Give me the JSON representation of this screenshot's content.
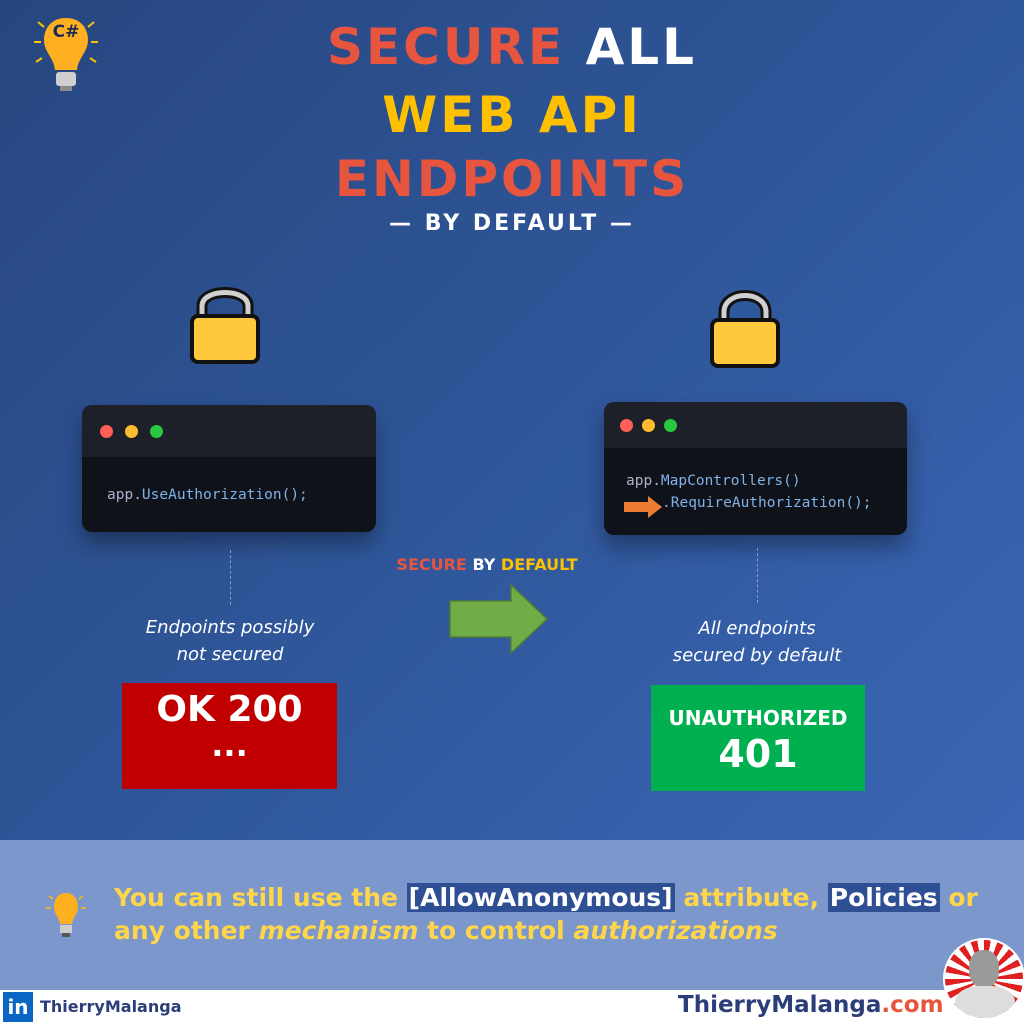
{
  "logo": {
    "text": "C#",
    "icon": "lightbulb-icon"
  },
  "title": {
    "secure": "SECURE",
    "all": "ALL",
    "web_api": "WEB API",
    "endpoints": "ENDPOINTS",
    "subtitle": "— BY DEFAULT —"
  },
  "left": {
    "icon": "padlock-open-icon",
    "code_prefix": "app.",
    "code_method": "UseAuthorization();",
    "caption_line1": "Endpoints possibly",
    "caption_line2": "not secured",
    "status_line1": "OK 200",
    "status_line2": "...",
    "status_color": "#c00000"
  },
  "middle": {
    "secure": "SECURE",
    "by": "BY",
    "default": "DEFAULT",
    "icon": "arrow-right-icon"
  },
  "right": {
    "icon": "padlock-closed-icon",
    "code_line1_prefix": "app.",
    "code_line1_method": "MapControllers()",
    "code_line2": ".RequireAuthorization();",
    "caption_line1": "All endpoints",
    "caption_line2": "secured by default",
    "status_line1": "UNAUTHORIZED",
    "status_line2": "401",
    "status_color": "#00b050"
  },
  "tip": {
    "p1": "You can still use the ",
    "h1": "[AllowAnonymous]",
    "p2": " attribute, ",
    "h2": "Policies",
    "p3": " or any other ",
    "i1": "mechanism",
    "p4": " to control ",
    "i2": "authorizations"
  },
  "footer": {
    "linkedin_name": "ThierryMalanga",
    "site_name": "ThierryMalanga",
    "site_tld": ".com"
  },
  "colors": {
    "orange": "#e8553f",
    "yellow": "#ffc000",
    "background": "#2f5699"
  }
}
